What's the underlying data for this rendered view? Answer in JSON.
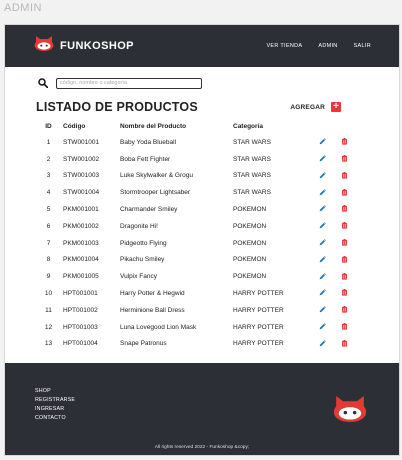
{
  "page_label": "ADMIN",
  "header": {
    "brand": "FUNKOSHOP",
    "nav": [
      "VER TIENDA",
      "ADMIN",
      "SALIR"
    ]
  },
  "search": {
    "placeholder": "código, nombre o categoría"
  },
  "title": "LISTADO DE PRODUCTOS",
  "add_label": "AGREGAR",
  "table": {
    "headers": [
      "ID",
      "Código",
      "Nombre del Producto",
      "Categoría"
    ],
    "rows": [
      {
        "id": "1",
        "code": "STW001001",
        "name": "Baby Yoda Blueball",
        "category": "STAR WARS"
      },
      {
        "id": "2",
        "code": "STW001002",
        "name": "Boba Fett Fighter",
        "category": "STAR WARS"
      },
      {
        "id": "3",
        "code": "STW001003",
        "name": "Luke Skylwalker & Grogu",
        "category": "STAR WARS"
      },
      {
        "id": "4",
        "code": "STW001004",
        "name": "Stormtrooper Lightsaber",
        "category": "STAR WARS"
      },
      {
        "id": "5",
        "code": "PKM001001",
        "name": "Charmander Smiley",
        "category": "POKEMON"
      },
      {
        "id": "6",
        "code": "PKM001002",
        "name": "Dragonite Hi!",
        "category": "POKEMON"
      },
      {
        "id": "7",
        "code": "PKM001003",
        "name": "Pidgeotto Flying",
        "category": "POKEMON"
      },
      {
        "id": "8",
        "code": "PKM001004",
        "name": "Pikachu Smiley",
        "category": "POKEMON"
      },
      {
        "id": "9",
        "code": "PKM001005",
        "name": "Vulpix Fancy",
        "category": "POKEMON"
      },
      {
        "id": "10",
        "code": "HPT001001",
        "name": "Harry Potter & Hegwid",
        "category": "HARRY POTTER"
      },
      {
        "id": "11",
        "code": "HPT001002",
        "name": "Herminione Ball Dress",
        "category": "HARRY POTTER"
      },
      {
        "id": "12",
        "code": "HPT001003",
        "name": "Luna Lovegood Lion Mask",
        "category": "HARRY POTTER"
      },
      {
        "id": "13",
        "code": "HPT001004",
        "name": "Snape Patronus",
        "category": "HARRY POTTER"
      }
    ]
  },
  "footer": {
    "links": [
      "SHOP",
      "REGISTRARSE",
      "INGRESAR",
      "CONTACTO"
    ],
    "copyright": "All rights reserved 2022 - Funkoshop &copy;"
  },
  "colors": {
    "dark": "#2d2f36",
    "accent": "#e53935",
    "edit": "#1e73be"
  },
  "icons": {
    "logo": "funko-head-icon",
    "search": "search-icon",
    "add": "plus-icon",
    "edit": "pencil-icon",
    "delete": "trash-icon"
  }
}
